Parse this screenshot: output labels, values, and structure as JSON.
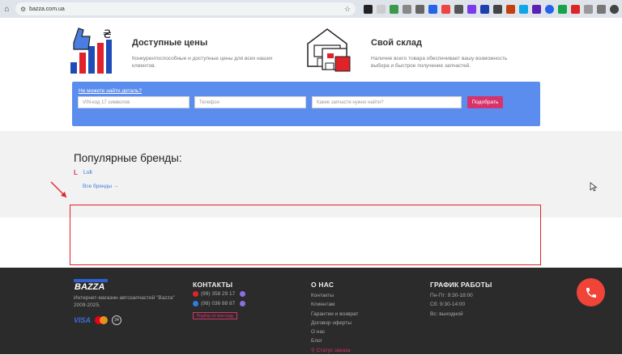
{
  "browser": {
    "url": "bazza.com.ua"
  },
  "features": [
    {
      "title": "Доступные цены",
      "text": "Конкурентоспособные и доступные цены для всех наших клиентов."
    },
    {
      "title": "Свой склад",
      "text": "Наличие всего товара обеспечивает вашу возможность выбора и быстрое получение запчастей."
    }
  ],
  "search": {
    "hint": "Не можете найти деталь?",
    "vin_placeholder": "VIN-код 17 символов",
    "phone_placeholder": "Телефон",
    "parts_placeholder": "Какие запчасти нужно найти?",
    "button": "Подобрать"
  },
  "brands": {
    "title": "Популярные бренды:",
    "items": [
      {
        "mark": "L",
        "name": "Luk"
      }
    ],
    "all_link": "Все бренды →"
  },
  "footer": {
    "logo": "BAZZA",
    "description": "Интернет-магазин автозапчастей \"Bazza\" 2009-2025.",
    "payments": {
      "visa": "VISA",
      "age": "24"
    },
    "contacts": {
      "title": "КОНТАКТЫ",
      "phone1": "(99) 358 29 17",
      "phone2": "(98) 036 88 87",
      "callback": "Подбор по вин-коду"
    },
    "about": {
      "title": "О НАС",
      "links": [
        "Контакты",
        "Клиентам",
        "Гарантии и возврат",
        "Договор оферты",
        "О нас",
        "Блог"
      ],
      "status": "Статус заказа"
    },
    "schedule": {
      "title": "ГРАФИК РАБОТЫ",
      "lines": [
        "Пн-Пт: 9:30-18:00",
        "Сб: 9:30-14:00",
        "Вс: выходной"
      ]
    }
  },
  "colors": {
    "accent": "#d6336c",
    "panel": "#5b8def",
    "footer": "#2b2b2b",
    "fab": "#f04438"
  }
}
